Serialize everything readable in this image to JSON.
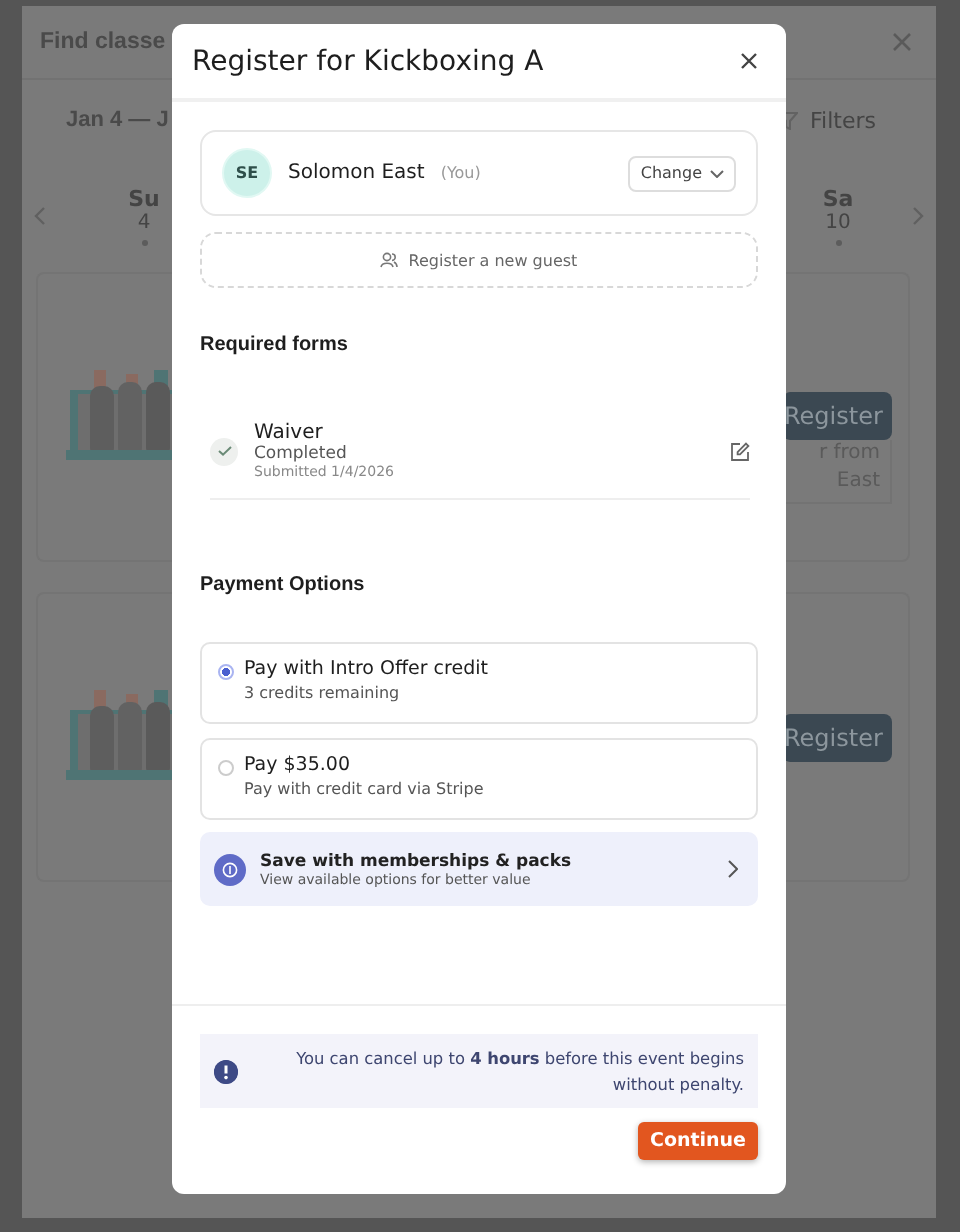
{
  "background": {
    "title": "Find classe",
    "date_range": "Jan 4 — J",
    "filters": "Filters",
    "days": [
      {
        "name": "Su",
        "date": "4",
        "dot": true
      },
      {
        "name": "Sa",
        "date": "10",
        "dot": true
      }
    ],
    "cards": [
      {
        "button": "Register",
        "note": [
          "r from",
          "East"
        ]
      },
      {
        "button": "Register"
      }
    ]
  },
  "dialog": {
    "title": "Register for Kickboxing A",
    "person": {
      "initials": "SE",
      "name": "Solomon East",
      "tag": "(You)",
      "change": "Change"
    },
    "guest_button": "Register a new guest",
    "forms_heading": "Required forms",
    "forms": [
      {
        "name": "Waiver",
        "status": "Completed",
        "submitted": "Submitted 1/4/2026",
        "completed": true
      }
    ],
    "payment_heading": "Payment Options",
    "payment_options": [
      {
        "title": "Pay with Intro Offer credit",
        "detail": "3 credits remaining",
        "selected": true
      },
      {
        "title": "Pay $35.00",
        "detail": "Pay with credit card via Stripe",
        "selected": false
      }
    ],
    "upsell": {
      "title": "Save with memberships & packs",
      "detail": "View available options for better value"
    },
    "notice": "You can cancel up to **4 hours** before this event begins without penalty.",
    "continue": "Continue"
  }
}
